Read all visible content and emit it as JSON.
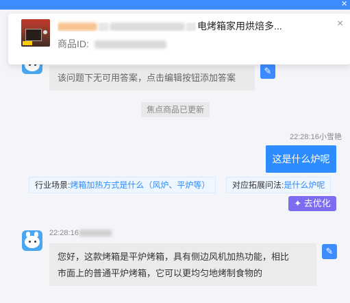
{
  "window": {
    "close_glyph": "×"
  },
  "product": {
    "title_suffix": "电烤箱家用烘焙多...",
    "id_label": "商品ID:",
    "close_glyph": "×",
    "thumb_icon": "oven-product-thumbnail"
  },
  "messages": {
    "no_answer": "该问题下无可用答案，点击编辑按钮添加答案",
    "system_note": "焦点商品已更新",
    "user_meta": "22:28:16小雪艳",
    "user_question": "这是什么炉呢",
    "chip_scene_label": "行业场景:",
    "chip_scene_value": "烤箱加热方式是什么（风炉、平炉等）",
    "chip_extend_label": "对应拓展问法:",
    "chip_extend_value": "是什么炉呢",
    "optimize_label": "去优化",
    "bot_meta_time": "22:28:16",
    "bot_reply_line1": "您好，这款烤箱是平炉烤箱，具有侧边风机加热功能，相比",
    "bot_reply_line2": "市面上的普通平炉烤箱，它可以更均匀地烤制食物的"
  },
  "colors": {
    "accent": "#2d8cff",
    "optimize": "#7b6cf0",
    "background": "#f4f5f9"
  },
  "icons": [
    "close-icon",
    "edit-icon",
    "magic-wand-icon",
    "bot-avatar"
  ]
}
